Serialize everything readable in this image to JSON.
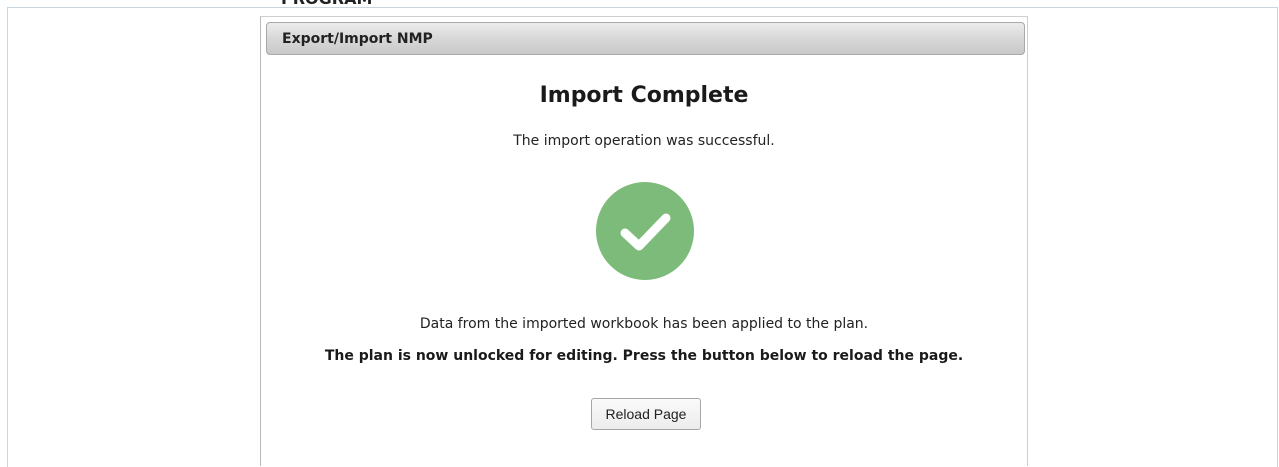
{
  "background": {
    "heading_fragment": "PROGRAM PLAN"
  },
  "dialog": {
    "title": "Export/Import NMP",
    "heading": "Import Complete",
    "success_message": "The import operation was successful.",
    "status_icon": "check-circle-icon",
    "status_color": "#7cbb7a",
    "applied_message": "Data from the imported workbook has been applied to the plan.",
    "unlocked_message": "The plan is now unlocked for editing. Press the button below to reload the page.",
    "reload_button_label": "Reload Page"
  }
}
